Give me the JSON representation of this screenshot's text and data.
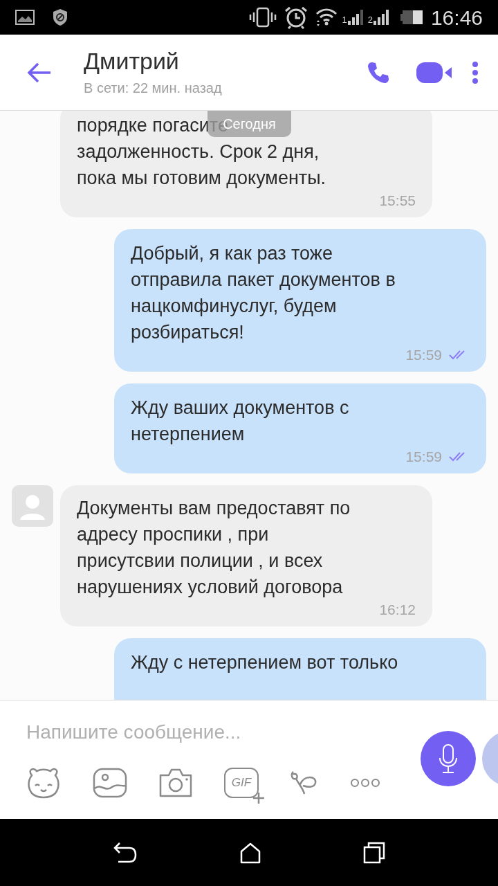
{
  "status_bar": {
    "time": "16:46",
    "sims": [
      "1",
      "2"
    ]
  },
  "header": {
    "title": "Дмитрий",
    "subtitle": "В сети: 22 мин. назад"
  },
  "date_badge": "Сегодня",
  "messages": [
    {
      "kind": "incoming",
      "show_avatar": false,
      "lines": [
        "порядке погасите",
        "задолженность. Срок 2 дня,",
        "пока мы готовим документы."
      ],
      "time": "15:55"
    },
    {
      "kind": "outgoing",
      "read": true,
      "lines": [
        "Добрый, я как раз тоже",
        "отправила пакет документов в",
        "нацкомфинуслуг, будем",
        "розбираться!"
      ],
      "time": "15:59"
    },
    {
      "kind": "outgoing",
      "read": true,
      "lines": [
        "Жду ваших документов с",
        "нетерпением"
      ],
      "time": "15:59"
    },
    {
      "kind": "incoming",
      "show_avatar": true,
      "lines": [
        "Документы вам предоставят по",
        "адресу проспики , при",
        "присутсвии полиции , и всех",
        "нарушениях условий договора"
      ],
      "time": "16:12"
    },
    {
      "kind": "outgoing",
      "lines": [
        "Жду с нетерпением вот только"
      ]
    }
  ],
  "composer": {
    "placeholder": "Напишите сообщение...",
    "gif_label": "GIF"
  }
}
